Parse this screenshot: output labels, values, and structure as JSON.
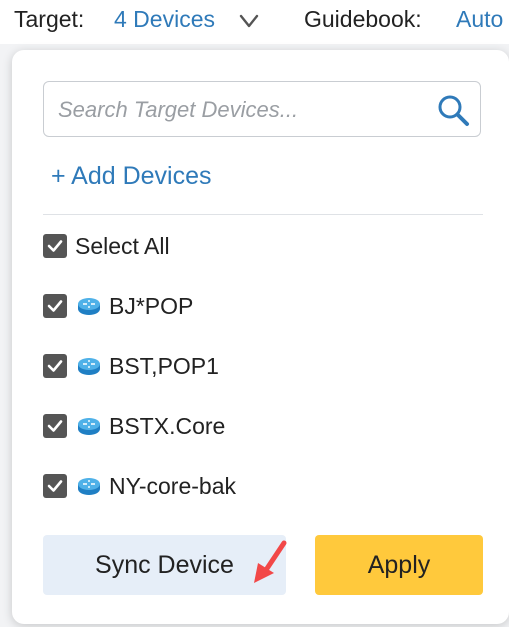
{
  "header": {
    "target_label": "Target:",
    "target_value": "4 Devices",
    "guidebook_label": "Guidebook:",
    "guidebook_value": "Auto"
  },
  "dropdown": {
    "search_placeholder": "Search Target Devices...",
    "search_value": "",
    "add_devices_label": "+ Add Devices",
    "select_all": {
      "label": "Select All",
      "checked": true
    },
    "devices": [
      {
        "name": "BJ*POP",
        "checked": true,
        "icon": "router-icon"
      },
      {
        "name": "BST,POP1",
        "checked": true,
        "icon": "router-icon"
      },
      {
        "name": "BSTX.Core",
        "checked": true,
        "icon": "router-icon"
      },
      {
        "name": "NY-core-bak",
        "checked": true,
        "icon": "router-icon"
      }
    ],
    "sync_button_label": "Sync Device",
    "apply_button_label": "Apply"
  },
  "colors": {
    "link": "#2f7ab9",
    "apply": "#ffc93c",
    "sync": "#e6eef8",
    "checkbox": "#555555",
    "annotation_arrow": "#f24848"
  }
}
